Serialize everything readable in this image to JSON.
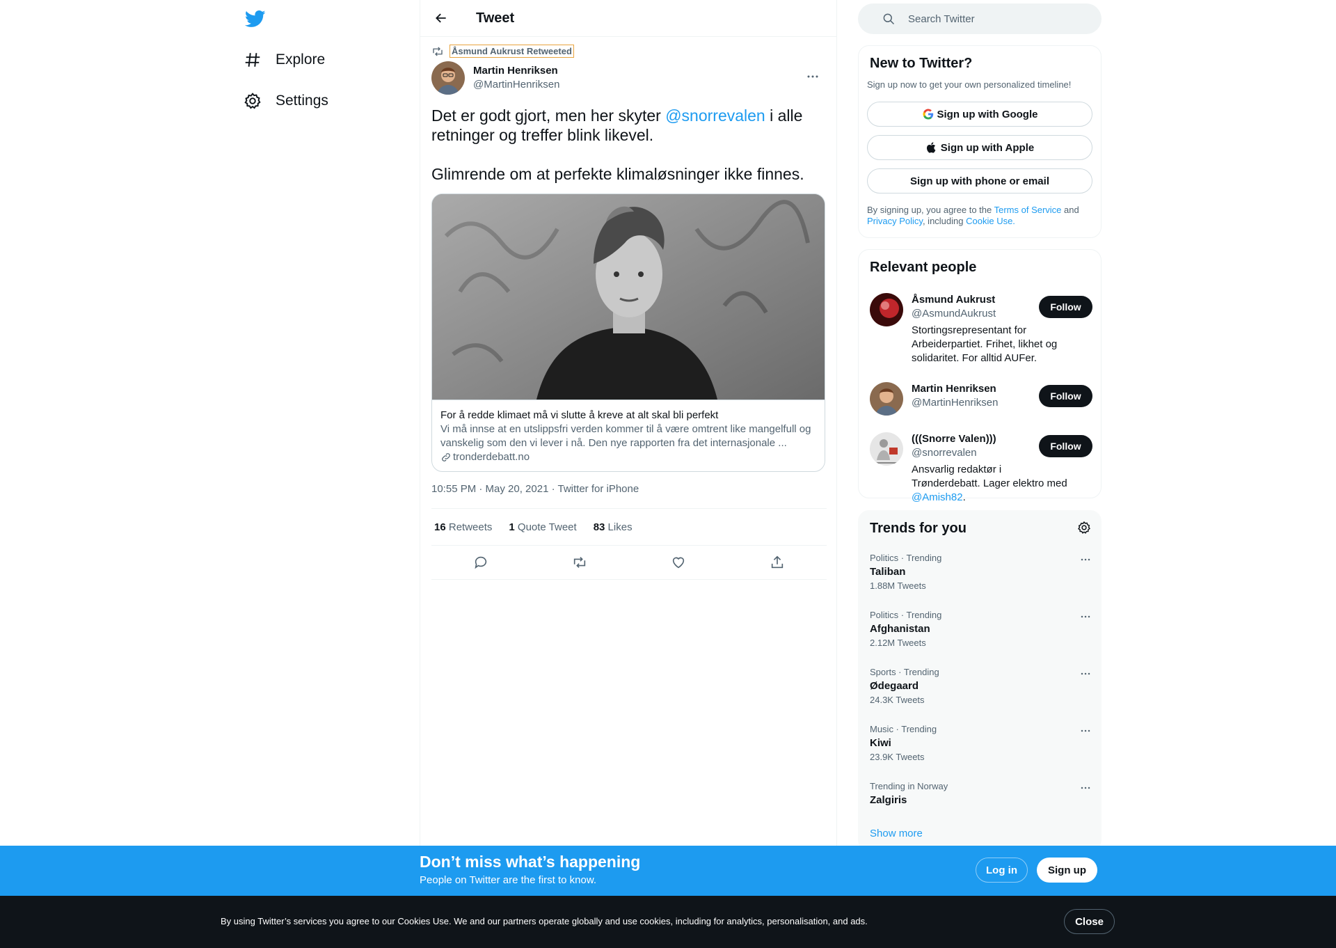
{
  "nav": {
    "explore_label": "Explore",
    "settings_label": "Settings"
  },
  "header": {
    "title": "Tweet"
  },
  "tweet": {
    "retweeted_by": "Åsmund Aukrust Retweeted",
    "author_name": "Martin Henriksen",
    "author_handle": "@MartinHenriksen",
    "text_part1": "Det er godt gjort, men her skyter ",
    "mention": "@snorrevalen",
    "text_part2": " i alle retninger og treffer blink likevel.",
    "text_para2": "Glimrende om at perfekte klimaløsninger ikke finnes.",
    "card": {
      "title": "For å redde klimaet må vi slutte å kreve at alt skal bli perfekt",
      "description": "Vi må innse at en utslippsfri verden kommer til å være omtrent like mangelfull og vanskelig som den vi lever i nå. Den nye rapporten fra det internasjonale ...",
      "domain": "tronderdebatt.no"
    },
    "meta": "10:55 PM · May 20, 2021 · Twitter for iPhone",
    "stats": {
      "retweets_count": "16",
      "retweets_label": "Retweets",
      "quotes_count": "1",
      "quotes_label": "Quote Tweet",
      "likes_count": "83",
      "likes_label": "Likes"
    }
  },
  "search": {
    "placeholder": "Search Twitter"
  },
  "signup": {
    "title": "New to Twitter?",
    "subtitle": "Sign up now to get your own personalized timeline!",
    "google": "Sign up with Google",
    "apple": "Sign up with Apple",
    "phone": "Sign up with phone or email",
    "legal_1": "By signing up, you agree to the ",
    "terms": "Terms of Service",
    "legal_2": " and ",
    "privacy": "Privacy Policy",
    "legal_3": ", including ",
    "cookie": "Cookie Use."
  },
  "people": {
    "title": "Relevant people",
    "follow_label": "Follow",
    "items": [
      {
        "name": "Åsmund Aukrust",
        "handle": "@AsmundAukrust",
        "bio": "Stortingsrepresentant for Arbeiderpartiet. Frihet, likhet og solidaritet. For alltid AUFer."
      },
      {
        "name": "Martin Henriksen",
        "handle": "@MartinHenriksen",
        "bio": ""
      },
      {
        "name": "(((Snorre Valen)))",
        "handle": "@snorrevalen",
        "bio_part1": "Ansvarlig redaktør i Trønderdebatt. Lager elektro med ",
        "bio_mention": "@Amish82",
        "bio_part2": "."
      }
    ]
  },
  "trends": {
    "title": "Trends for you",
    "items": [
      {
        "category": "Politics · Trending",
        "name": "Taliban",
        "count": "1.88M Tweets"
      },
      {
        "category": "Politics · Trending",
        "name": "Afghanistan",
        "count": "2.12M Tweets"
      },
      {
        "category": "Sports · Trending",
        "name": "Ødegaard",
        "count": "24.3K Tweets"
      },
      {
        "category": "Music · Trending",
        "name": "Kiwi",
        "count": "23.9K Tweets"
      },
      {
        "category": "Trending in Norway",
        "name": "Zalgiris",
        "count": ""
      }
    ],
    "show_more": "Show more"
  },
  "promo": {
    "title": "Don’t miss what’s happening",
    "subtitle": "People on Twitter are the first to know.",
    "login": "Log in",
    "signup": "Sign up"
  },
  "cookie_bar": {
    "text": "By using Twitter’s services you agree to our Cookies Use. We and our partners operate globally and use cookies, including for analytics, personalisation, and ads.",
    "close": "Close"
  },
  "colors": {
    "accent": "#1d9bf0",
    "text_primary": "#0f1419",
    "text_secondary": "#536471",
    "cookie_bg": "#0f1419"
  }
}
